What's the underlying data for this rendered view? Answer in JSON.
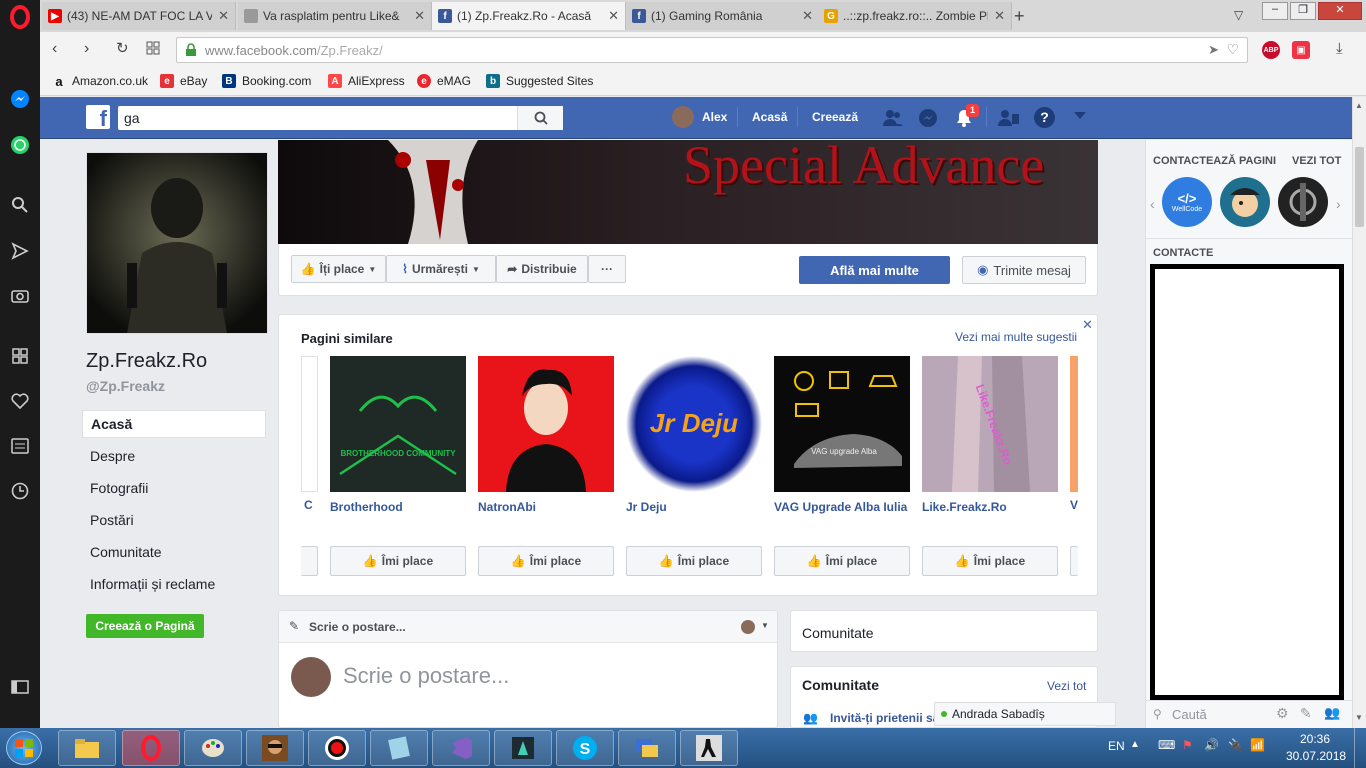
{
  "browser": {
    "tabs": [
      {
        "label": "(43) NE-AM DAT FOC LA V",
        "favicon": "youtube-icon"
      },
      {
        "label": "Va rasplatim pentru Like&",
        "favicon": "page-icon"
      },
      {
        "label": "(1) Zp.Freakz.Ro - Acasă",
        "favicon": "facebook-icon"
      },
      {
        "label": "(1) Gaming România",
        "favicon": "facebook-icon"
      },
      {
        "label": "..::zp.freakz.ro::.. Zombie Pl",
        "favicon": "game-icon"
      }
    ],
    "url": "www.facebook.com/Zp.Freakz/",
    "url_host": "www.facebook.com",
    "url_path": "/Zp.Freakz/",
    "bookmarks": [
      "Amazon.co.uk",
      "eBay",
      "Booking.com",
      "AliExpress",
      "eMAG",
      "Suggested Sites"
    ],
    "adblock_label": "ABP"
  },
  "fb": {
    "search_value": "ga",
    "user_name": "Alex",
    "nav_home": "Acasă",
    "nav_create": "Creează",
    "notif_count": "1",
    "page_name": "Zp.Freakz.Ro",
    "page_handle": "@Zp.Freakz",
    "cover_text": "Special Advance",
    "side_nav": [
      "Acasă",
      "Despre",
      "Fotografii",
      "Postări",
      "Comunitate",
      "Informații și reclame"
    ],
    "create_page_btn": "Creează o Pagină",
    "action_like": "Îți place",
    "action_follow": "Urmărești",
    "action_share": "Distribuie",
    "action_more": "···",
    "learn_more": "Află mai multe",
    "send_message": "Trimite mesaj",
    "similar_title": "Pagini similare",
    "similar_more": "Vezi mai multe sugestii",
    "similar_partial_left": "C",
    "similar_partial_right": "V",
    "similar_pages": [
      {
        "name": "Brotherhood",
        "like": "Îmi place",
        "image_text": "BROTHERHOOD COMMUNITY"
      },
      {
        "name": "NatronAbi",
        "like": "Îmi place",
        "image_text": ""
      },
      {
        "name": "Jr Deju",
        "like": "Îmi place",
        "image_text": "Jr Deju"
      },
      {
        "name": "VAG Upgrade Alba Iulia",
        "like": "Îmi place",
        "image_text": "VAG upgrade Alba"
      },
      {
        "name": "Like.Freakz.Ro",
        "like": "Îmi place",
        "image_text": "Like.Freakz.Ro"
      }
    ],
    "composer_header": "Scrie o postare...",
    "composer_placeholder": "Scrie o postare...",
    "community_box": "Comunitate",
    "community_title": "Comunitate",
    "community_see_all": "Vezi tot",
    "invite_friends": "Invită-ți prietenii să",
    "online_friend": "Andrada Sabadîș"
  },
  "chat": {
    "contact_pages": "CONTACTEAZĂ PAGINI",
    "see_all": "VEZI TOT",
    "contacts": "CONTACTE",
    "search_placeholder": "Caută",
    "bubble_labels": [
      "WellCode",
      "",
      ""
    ]
  },
  "taskbar": {
    "lang": "EN",
    "time": "20:36",
    "date": "30.07.2018"
  },
  "colors": {
    "fb_blue": "#4267b2",
    "link_blue": "#365899",
    "green_button": "#42b72a",
    "opera_red": "#ff1b2d"
  }
}
